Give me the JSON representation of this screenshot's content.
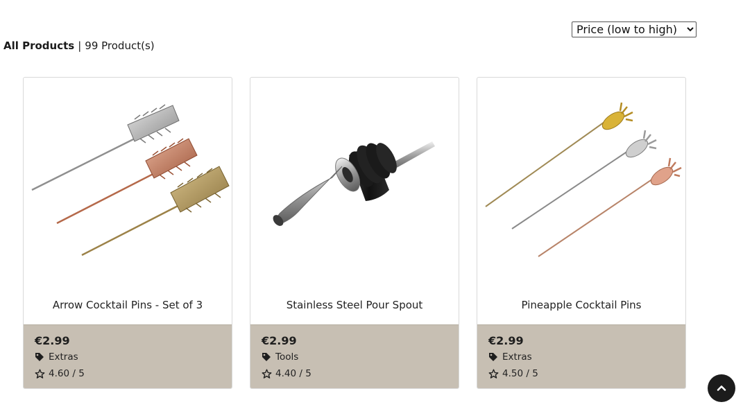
{
  "sort": {
    "selected": "Price (low to high)"
  },
  "heading": {
    "title": "All Products",
    "separator": "|",
    "count": "99 Product(s)"
  },
  "products": [
    {
      "name": "Arrow Cocktail Pins - Set of 3",
      "price": "€2.99",
      "category": "Extras",
      "rating": "4.60 / 5",
      "image_icon": "arrow-pins-image"
    },
    {
      "name": "Stainless Steel Pour Spout",
      "price": "€2.99",
      "category": "Tools",
      "rating": "4.40 / 5",
      "image_icon": "pour-spout-image"
    },
    {
      "name": "Pineapple Cocktail Pins",
      "price": "€2.99",
      "category": "Extras",
      "rating": "4.50 / 5",
      "image_icon": "pineapple-pins-image"
    }
  ],
  "icons": {
    "category": "tag-icon",
    "rating": "star-outline-icon",
    "scroll_top": "chevron-up-icon"
  },
  "colors": {
    "info_panel": "#c7bfb3",
    "scroll_button": "#1c1c1c"
  }
}
